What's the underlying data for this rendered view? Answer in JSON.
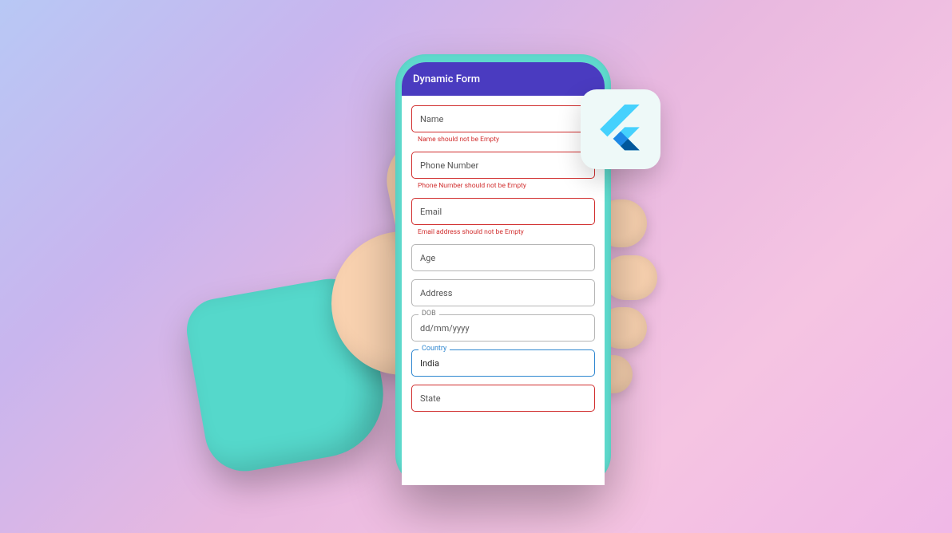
{
  "appBar": {
    "title": "Dynamic Form"
  },
  "fields": {
    "name": {
      "placeholder": "Name",
      "error": "Name should not be Empty"
    },
    "phone": {
      "placeholder": "Phone Number",
      "error": "Phone Number should not be Empty"
    },
    "email": {
      "placeholder": "Email",
      "error": "Email address should not be Empty"
    },
    "age": {
      "placeholder": "Age"
    },
    "address": {
      "placeholder": "Address"
    },
    "dob": {
      "label": "DOB",
      "value": "dd/mm/yyyy"
    },
    "country": {
      "label": "Country",
      "value": "India"
    },
    "state": {
      "placeholder": "State"
    }
  },
  "colors": {
    "appBar": "#4a3bc0",
    "phoneFrame": "#5ed9cc",
    "error": "#d12e2e",
    "active": "#2f87d0",
    "forearm": "#55d8cb",
    "skin": "#f9d2b0"
  }
}
